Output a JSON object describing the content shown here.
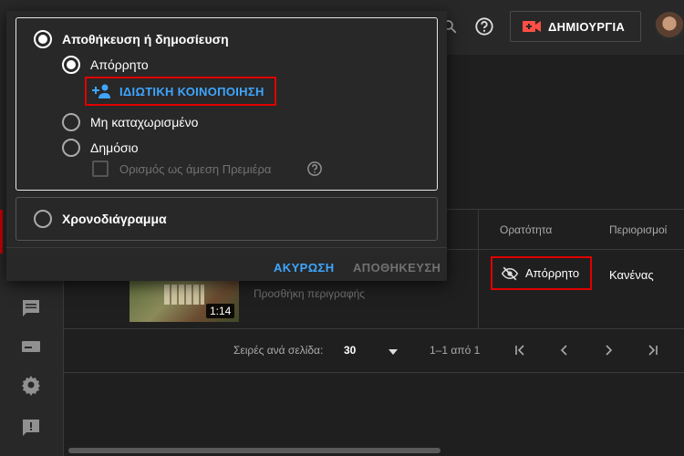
{
  "header": {
    "create_label": "ΔΗΜΙΟΥΡΓΙΑ"
  },
  "table": {
    "col_visibility": "Ορατότητα",
    "col_restrictions": "Περιορισμοί",
    "row": {
      "duration": "1:14",
      "description_placeholder": "Προσθήκη περιγραφής",
      "visibility": "Απόρρητο",
      "restrictions": "Κανένας"
    }
  },
  "pagination": {
    "rows_per_page_label": "Σειρές ανά σελίδα:",
    "rows_per_page_value": "30",
    "range": "1–1 από 1"
  },
  "dialog": {
    "save_or_publish": "Αποθήκευση ή δημοσίευση",
    "private": "Απόρρητο",
    "private_share": "ΙΔΙΩΤΙΚΗ ΚΟΙΝΟΠΟΙΗΣΗ",
    "unlisted": "Μη καταχωρισμένο",
    "public": "Δημόσιο",
    "premiere": "Ορισμός ως άμεση Πρεμιέρα",
    "schedule": "Χρονοδιάγραμμα",
    "cancel": "ΑΚΥΡΩΣΗ",
    "save": "ΑΠΟΘΗΚΕΥΣΗ"
  },
  "colors": {
    "accent_blue": "#3ea6ff",
    "highlight_red": "#e00000",
    "brand_red": "#cc0000"
  }
}
